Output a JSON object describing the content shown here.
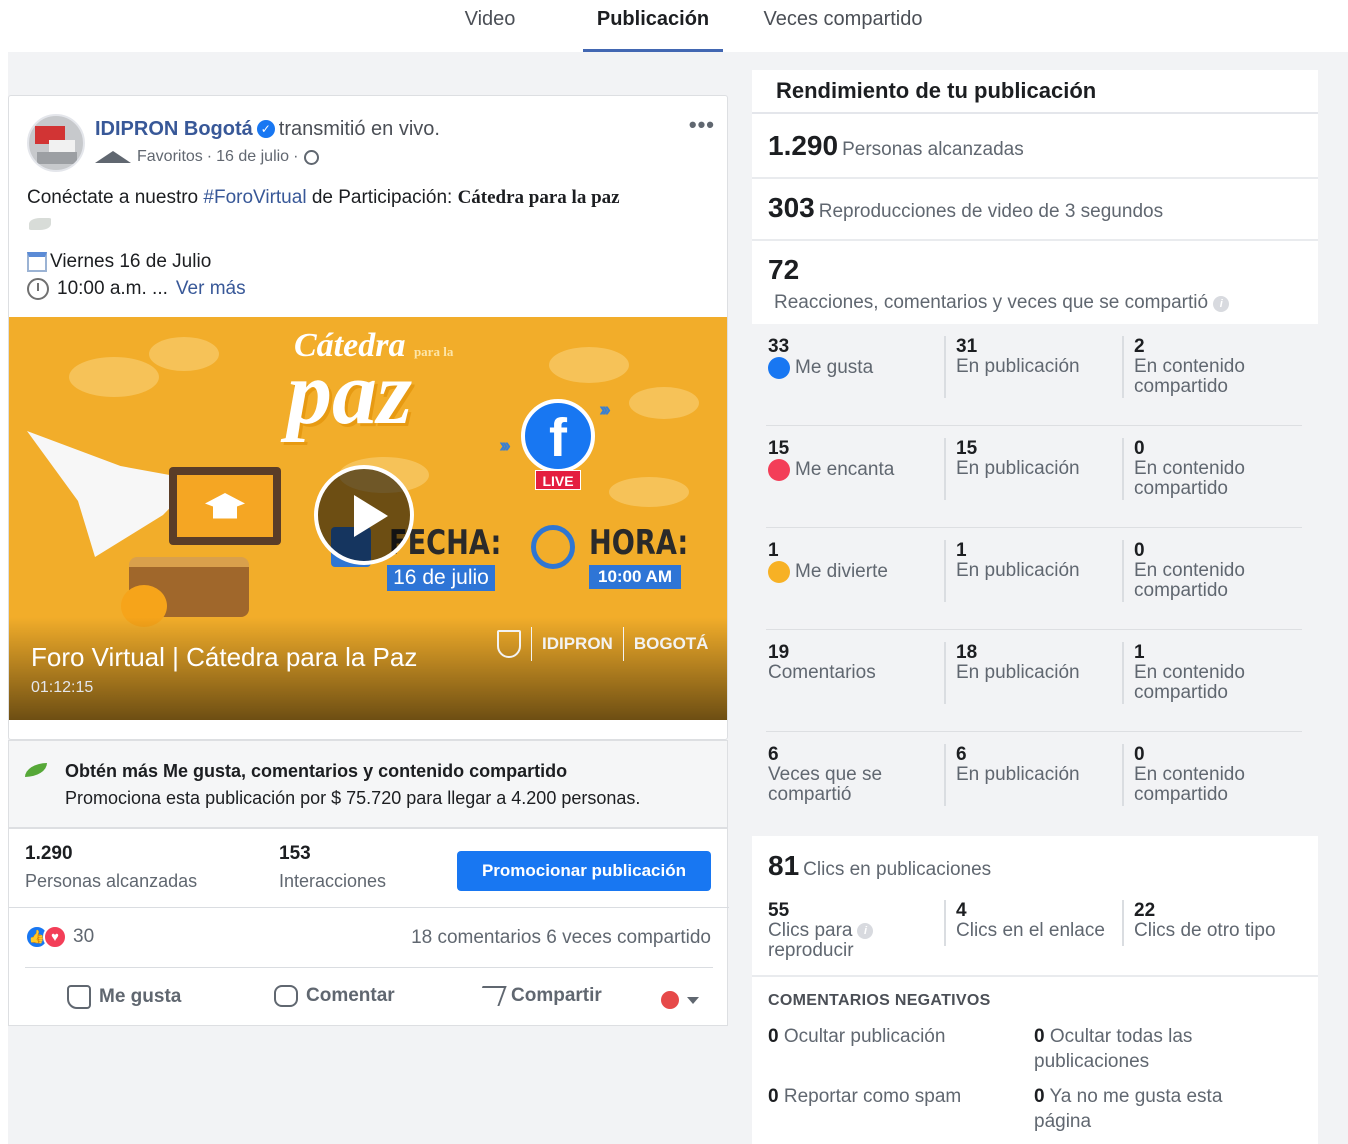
{
  "tabs": [
    {
      "label": "Video",
      "active": false
    },
    {
      "label": "Publicación",
      "active": true
    },
    {
      "label": "Veces compartido",
      "active": false
    }
  ],
  "post": {
    "page_name": "IDIPRON Bogotá",
    "action": "transmitió en vivo.",
    "audience": "Favoritos",
    "date": "16 de julio",
    "more_icon": "more-options-icon",
    "text_prefix": "Conéctate a nuestro ",
    "hashtag": "#ForoVirtual",
    "text_middle": " de Participación: ",
    "text_bold": "Cátedra para la paz",
    "date_line": "Viernes 16 de Julio",
    "time_line": "10:00 a.m. ...",
    "see_more": "Ver más",
    "video": {
      "brand_top": "Cátedra",
      "brand_small": "para la",
      "brand_big": "paz",
      "live_badge": "LIVE",
      "fecha_label": "FECHA:",
      "fecha_value": "16 de julio",
      "hora_label": "HORA:",
      "hora_value": "10:00 AM",
      "org_logo": "IDIPRON",
      "city_logo": "BOGOTÁ",
      "title": "Foro Virtual | Cátedra para la Paz",
      "duration": "01:12:15"
    }
  },
  "promo": {
    "title": "Obtén más Me gusta, comentarios y contenido compartido",
    "subtitle": "Promociona esta publicación por $ 75.720 para llegar a 4.200 personas."
  },
  "post_stats": {
    "reached_value": "1.290",
    "reached_label": "Personas alcanzadas",
    "interactions_value": "153",
    "interactions_label": "Interacciones",
    "boost_button": "Promocionar publicación",
    "reactions_count": "30",
    "comments": "18 comentarios",
    "shares": "6 veces compartido",
    "like_action": "Me gusta",
    "comment_action": "Comentar",
    "share_action": "Compartir"
  },
  "panel": {
    "title": "Rendimiento de tu publicación",
    "reach_value": "1.290",
    "reach_label": "Personas alcanzadas",
    "plays_value": "303",
    "plays_label": "Reproducciones de video de 3 segundos",
    "engagement_value": "72",
    "engagement_label": "Reacciones, comentarios y veces que se compartió",
    "rows": [
      {
        "total": "33",
        "label": "Me gusta",
        "icon": "like",
        "on_post": "31",
        "on_post_label": "En publicación",
        "on_shared": "2",
        "on_shared_label1": "En contenido",
        "on_shared_label2": "compartido"
      },
      {
        "total": "15",
        "label": "Me encanta",
        "icon": "love",
        "on_post": "15",
        "on_post_label": "En publicación",
        "on_shared": "0",
        "on_shared_label1": "En contenido",
        "on_shared_label2": "compartido"
      },
      {
        "total": "1",
        "label": "Me divierte",
        "icon": "haha",
        "on_post": "1",
        "on_post_label": "En publicación",
        "on_shared": "0",
        "on_shared_label1": "En contenido",
        "on_shared_label2": "compartido"
      },
      {
        "total": "19",
        "label": "Comentarios",
        "icon": "",
        "on_post": "18",
        "on_post_label": "En publicación",
        "on_shared": "1",
        "on_shared_label1": "En contenido",
        "on_shared_label2": "compartido"
      },
      {
        "total": "6",
        "label": "Veces que se",
        "label2": "compartió",
        "icon": "",
        "on_post": "6",
        "on_post_label": "En publicación",
        "on_shared": "0",
        "on_shared_label1": "En contenido",
        "on_shared_label2": "compartido"
      }
    ],
    "clicks_value": "81",
    "clicks_label": "Clics en publicaciones",
    "clicks": [
      {
        "value": "55",
        "label1": "Clics para",
        "label2": "reproducir"
      },
      {
        "value": "4",
        "label1": "Clics en el enlace"
      },
      {
        "value": "22",
        "label1": "Clics de otro tipo"
      }
    ],
    "negative_title": "COMENTARIOS NEGATIVOS",
    "negative": [
      {
        "value": "0",
        "label": "Ocultar publicación"
      },
      {
        "value": "0",
        "label": "Ocultar todas las",
        "label2": "publicaciones"
      },
      {
        "value": "0",
        "label": "Reportar como spam"
      },
      {
        "value": "0",
        "label": "Ya no me gusta esta",
        "label2": "página"
      }
    ]
  }
}
